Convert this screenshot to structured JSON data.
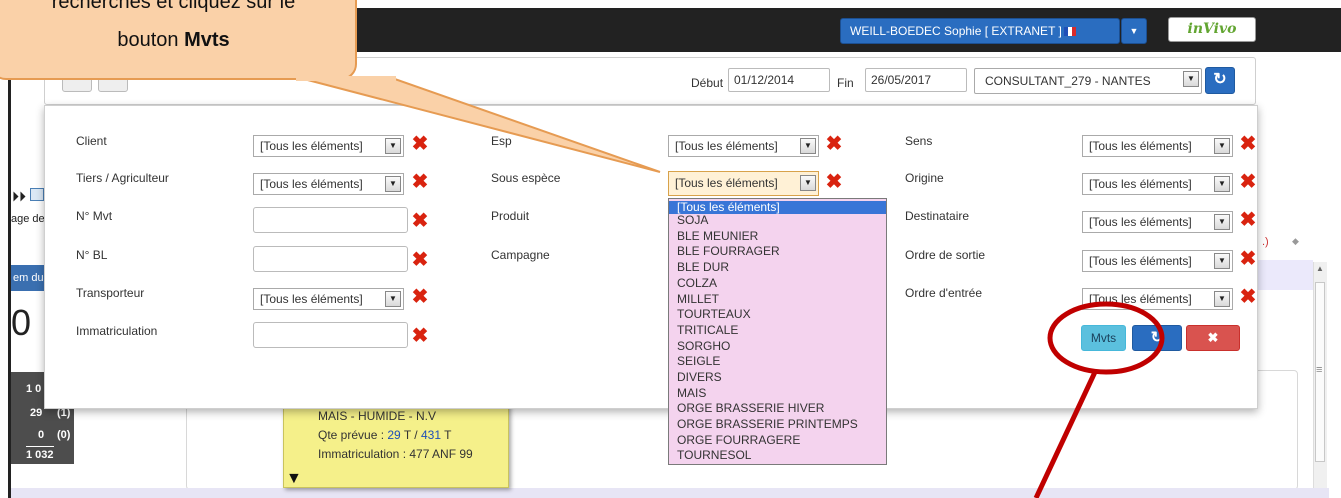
{
  "navbar": {
    "user_label": "WEILL-BOEDEC Sophie [ EXTRANET ]",
    "logo_text": "inVivo"
  },
  "filter_bar": {
    "debut_label": "Début",
    "debut_value": "01/12/2014",
    "fin_label": "Fin",
    "fin_value": "26/05/2017",
    "consultant_value": "CONSULTANT_279 - NANTES"
  },
  "filters": {
    "col1": [
      {
        "label": "Client",
        "value": "[Tous les éléments]",
        "kind": "select"
      },
      {
        "label": "Tiers / Agriculteur",
        "value": "[Tous les éléments]",
        "kind": "select"
      },
      {
        "label": "N° Mvt",
        "value": "",
        "kind": "text"
      },
      {
        "label": "N° BL",
        "value": "",
        "kind": "text"
      },
      {
        "label": "Transporteur",
        "value": "[Tous les éléments]",
        "kind": "select"
      },
      {
        "label": "Immatriculation",
        "value": "",
        "kind": "text"
      }
    ],
    "col2": [
      {
        "label": "Esp",
        "value": "[Tous les éléments]",
        "kind": "select"
      },
      {
        "label": "Sous espèce",
        "value": "[Tous les éléments]",
        "kind": "select"
      },
      {
        "label": "Produit",
        "value": "",
        "kind": "none"
      },
      {
        "label": "Campagne",
        "value": "",
        "kind": "none"
      }
    ],
    "col3": [
      {
        "label": "Sens",
        "value": "[Tous les éléments]",
        "kind": "select"
      },
      {
        "label": "Origine",
        "value": "[Tous les éléments]",
        "kind": "select"
      },
      {
        "label": "Destinataire",
        "value": "[Tous les éléments]",
        "kind": "select"
      },
      {
        "label": "Ordre de sortie",
        "value": "[Tous les éléments]",
        "kind": "select"
      },
      {
        "label": "Ordre d'entrée",
        "value": "[Tous les éléments]",
        "kind": "select"
      }
    ]
  },
  "buttons": {
    "mvts": "Mvts",
    "refresh_icon": "refresh-icon",
    "cancel_icon": "close-icon",
    "cancel_glyph": "✖",
    "refresh_glyph": "↻"
  },
  "dropdown_options": [
    "[Tous les éléments]",
    "SOJA",
    "BLE MEUNIER",
    "BLE FOURRAGER",
    "BLE DUR",
    "COLZA",
    "MILLET",
    "TOURTEAUX",
    "TRITICALE",
    "SORGHO",
    "SEIGLE",
    "DIVERS",
    "MAIS",
    "ORGE BRASSERIE HIVER",
    "ORGE BRASSERIE PRINTEMPS",
    "ORGE FOURRAGERE",
    "TOURNESOL"
  ],
  "background": {
    "age_de": "age de",
    "em_du": "em du",
    "big_zero": "0",
    "stats": [
      "1 0",
      "29",
      "(1)",
      "0",
      "(0)",
      "1 032"
    ],
    "note_line1": "MAIS - HUMIDE - N.V",
    "note_qte_prefix": "Qte prévue : ",
    "note_qte_val1": "29",
    "note_qte_mid": " T  / ",
    "note_qte_val2": "431",
    "note_qte_suffix": " T",
    "note_immat": "Immatriculation : 477 ANF 99",
    "paren_glyph": ".)",
    "scroll_glyph": "≡"
  },
  "callout": {
    "line1": "recherches et cliquez sur le",
    "line2_prefix": "bouton ",
    "line2_bold": "Mvts"
  },
  "colors": {
    "annotation_red": "#c00000",
    "callout_fill": "#fad1a8",
    "callout_border": "#e69b52",
    "primary_blue": "#2a6dc0",
    "info_button": "#5bc0de",
    "danger_button": "#d9534f",
    "dropdown_bg": "#f4d3ee"
  }
}
